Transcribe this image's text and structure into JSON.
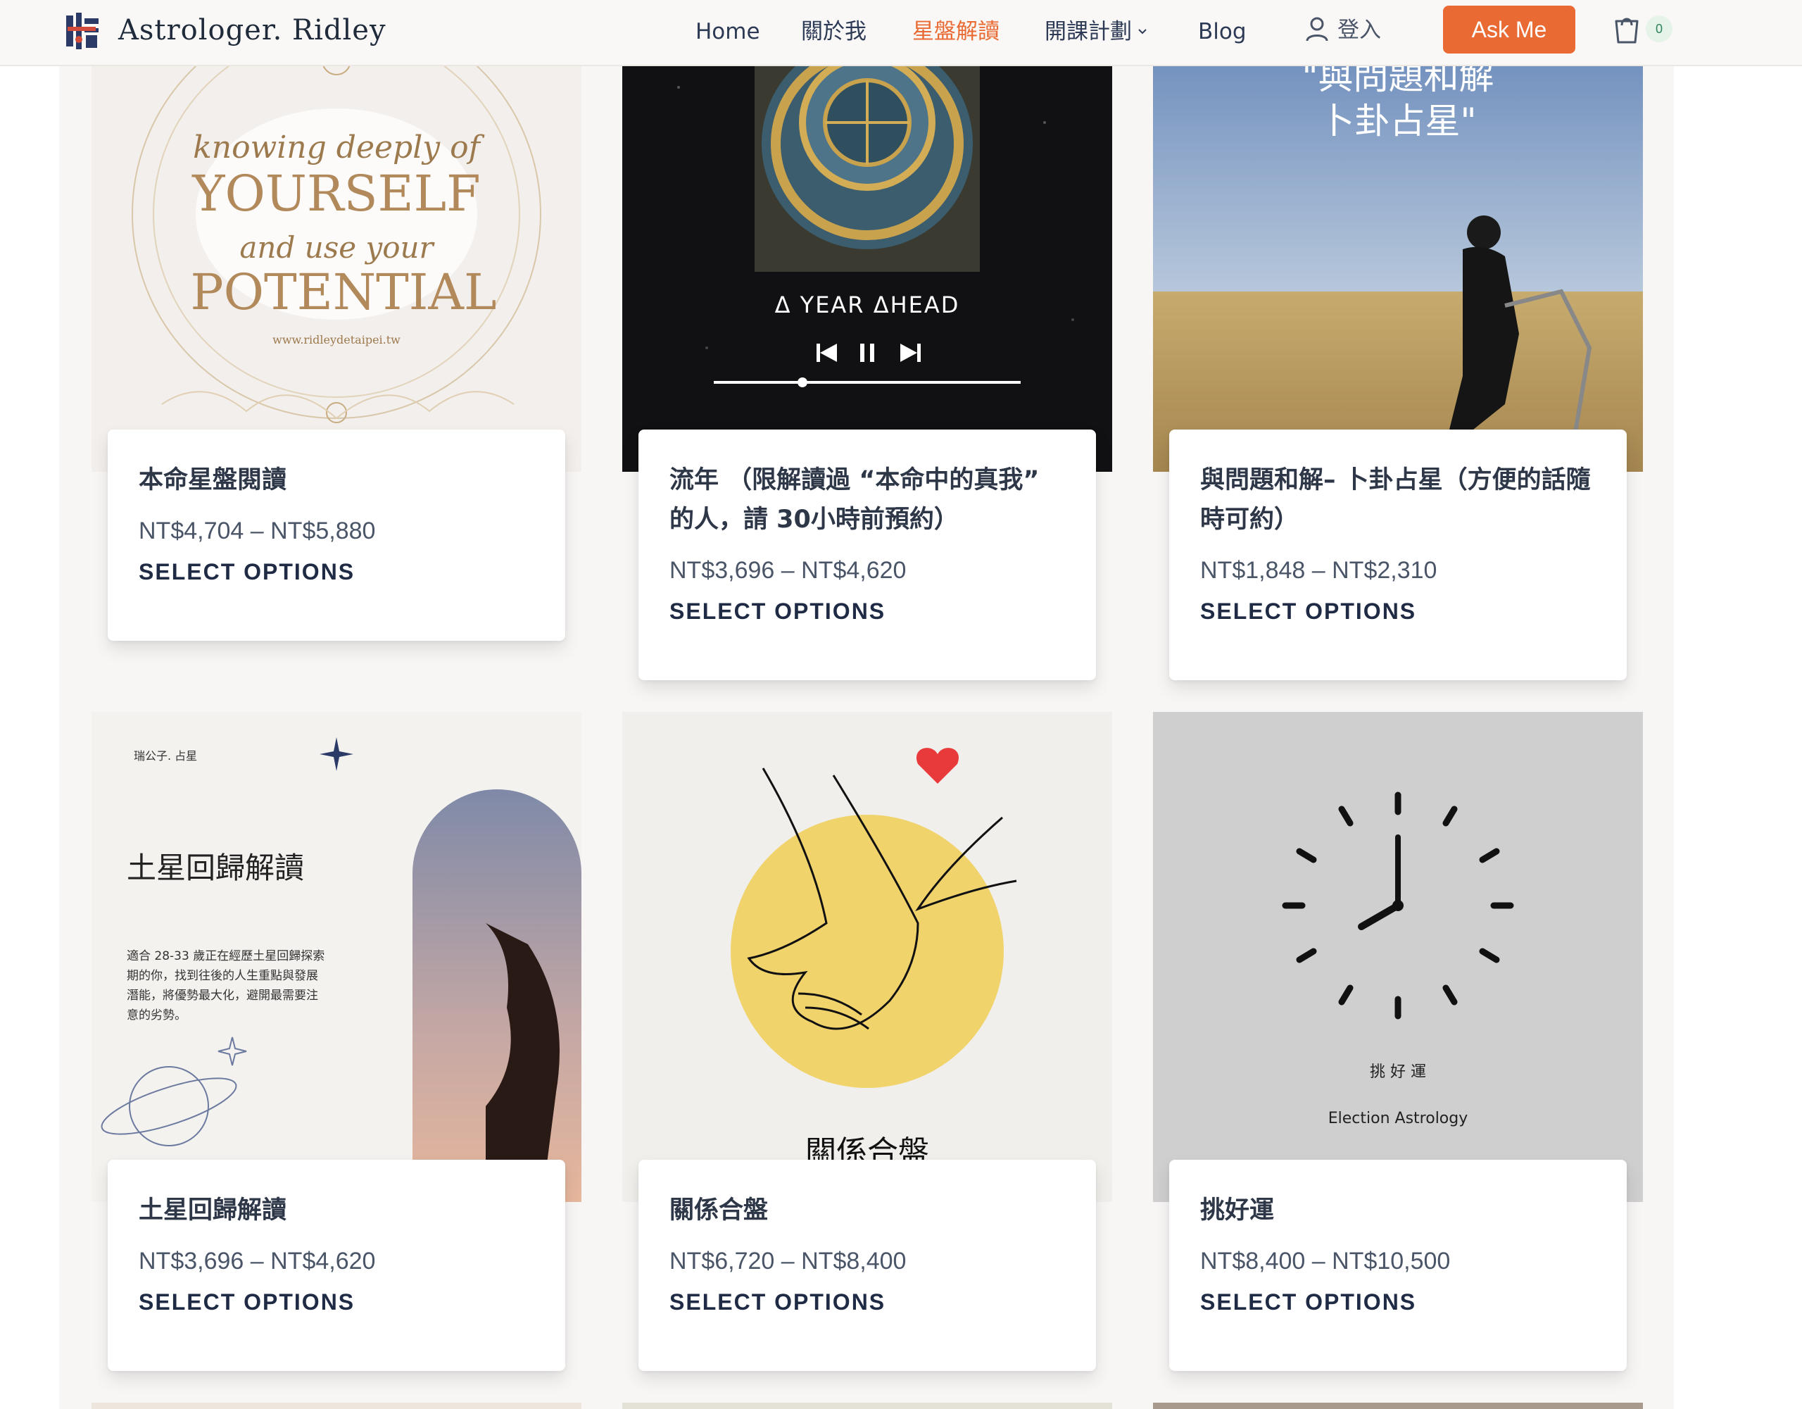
{
  "header": {
    "logo_text": "Astrologer. Ridley",
    "nav": [
      {
        "label": "Home",
        "active": false
      },
      {
        "label": "關於我",
        "active": false
      },
      {
        "label": "星盤解讀",
        "active": true
      },
      {
        "label": "開課計劃",
        "active": false
      },
      {
        "label": "Blog",
        "active": false
      }
    ],
    "login_label": "登入",
    "ask_label": "Ask Me",
    "cart_count": "0"
  },
  "colors": {
    "accent": "#ea6a33",
    "nav_text": "#2d3a55",
    "page_bg": "#f8f6f5"
  },
  "products": [
    {
      "title": "本命星盤閱讀",
      "price": "NT$4,704 – NT$5,880",
      "button": "SELECT OPTIONS",
      "image_text": {
        "line1": "knowing deeply of",
        "line2": "YOURSELF",
        "line3": "and use your",
        "line4": "POTENTIAL",
        "url": "www.ridleydetaipei.tw"
      }
    },
    {
      "title": "流年 （限解讀過 “本命中的真我” 的人，請 30小時前預約）",
      "price": "NT$3,696 – NT$4,620",
      "button": "SELECT OPTIONS",
      "image_text": {
        "caption": "Δ YEAR ΔHEAD"
      }
    },
    {
      "title": "與問題和解– 卜卦占星（方便的話隨時可約）",
      "price": "NT$1,848 – NT$2,310",
      "button": "SELECT OPTIONS",
      "image_text": {
        "line1": "\"與問題和解",
        "line2": "卜卦占星\""
      }
    },
    {
      "title": "土星回歸解讀",
      "price": "NT$3,696 – NT$4,620",
      "button": "SELECT OPTIONS",
      "image_text": {
        "brand": "瑞公子. 占星",
        "heading": "土星回歸解讀",
        "body1": "適合 28-33 歲正在經歷土星回歸探索",
        "body2": "期的你，找到往後的人生重點與發展",
        "body3": "潛能，將優勢最大化，避開最需要注",
        "body4": "意的劣勢。"
      }
    },
    {
      "title": "關係合盤",
      "price": "NT$6,720 – NT$8,400",
      "button": "SELECT OPTIONS",
      "image_text": {
        "caption": "關係合盤"
      }
    },
    {
      "title": "挑好運",
      "price": "NT$8,400 – NT$10,500",
      "button": "SELECT OPTIONS",
      "image_text": {
        "caption_zh": "挑 好 運",
        "caption_en": "Election Astrology"
      }
    }
  ]
}
